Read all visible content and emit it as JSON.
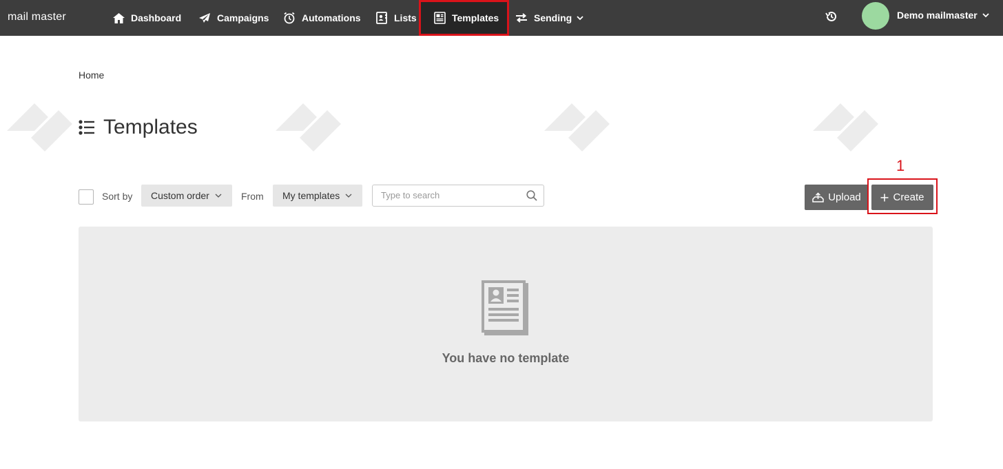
{
  "app": {
    "logo_text": "mail master"
  },
  "nav": {
    "items": [
      {
        "label": "Dashboard",
        "icon": "home-icon"
      },
      {
        "label": "Campaigns",
        "icon": "paper-plane-icon"
      },
      {
        "label": "Automations",
        "icon": "alarm-clock-icon"
      },
      {
        "label": "Lists",
        "icon": "contacts-book-icon"
      },
      {
        "label": "Templates",
        "icon": "template-icon",
        "active": true
      },
      {
        "label": "Sending",
        "icon": "swap-arrows-icon",
        "has_dropdown": true
      }
    ],
    "history_icon": "history-icon",
    "user": {
      "name": "Demo mailmaster",
      "avatar_color": "#9cd9a0"
    }
  },
  "breadcrumb": {
    "home": "Home"
  },
  "page": {
    "title": "Templates",
    "title_icon": "list-icon"
  },
  "toolbar": {
    "sort_label": "Sort by",
    "sort_value": "Custom order",
    "from_label": "From",
    "from_value": "My templates",
    "search_placeholder": "Type to search",
    "upload_label": "Upload",
    "create_label": "Create"
  },
  "annotation": {
    "step": "1",
    "color": "#d9131a"
  },
  "empty_state": {
    "message": "You have no template"
  },
  "colors": {
    "topbar": "#3d3d3d",
    "active_nav": "#262626",
    "button": "#666666",
    "highlight": "#d9131a",
    "empty_bg": "#ececec"
  }
}
